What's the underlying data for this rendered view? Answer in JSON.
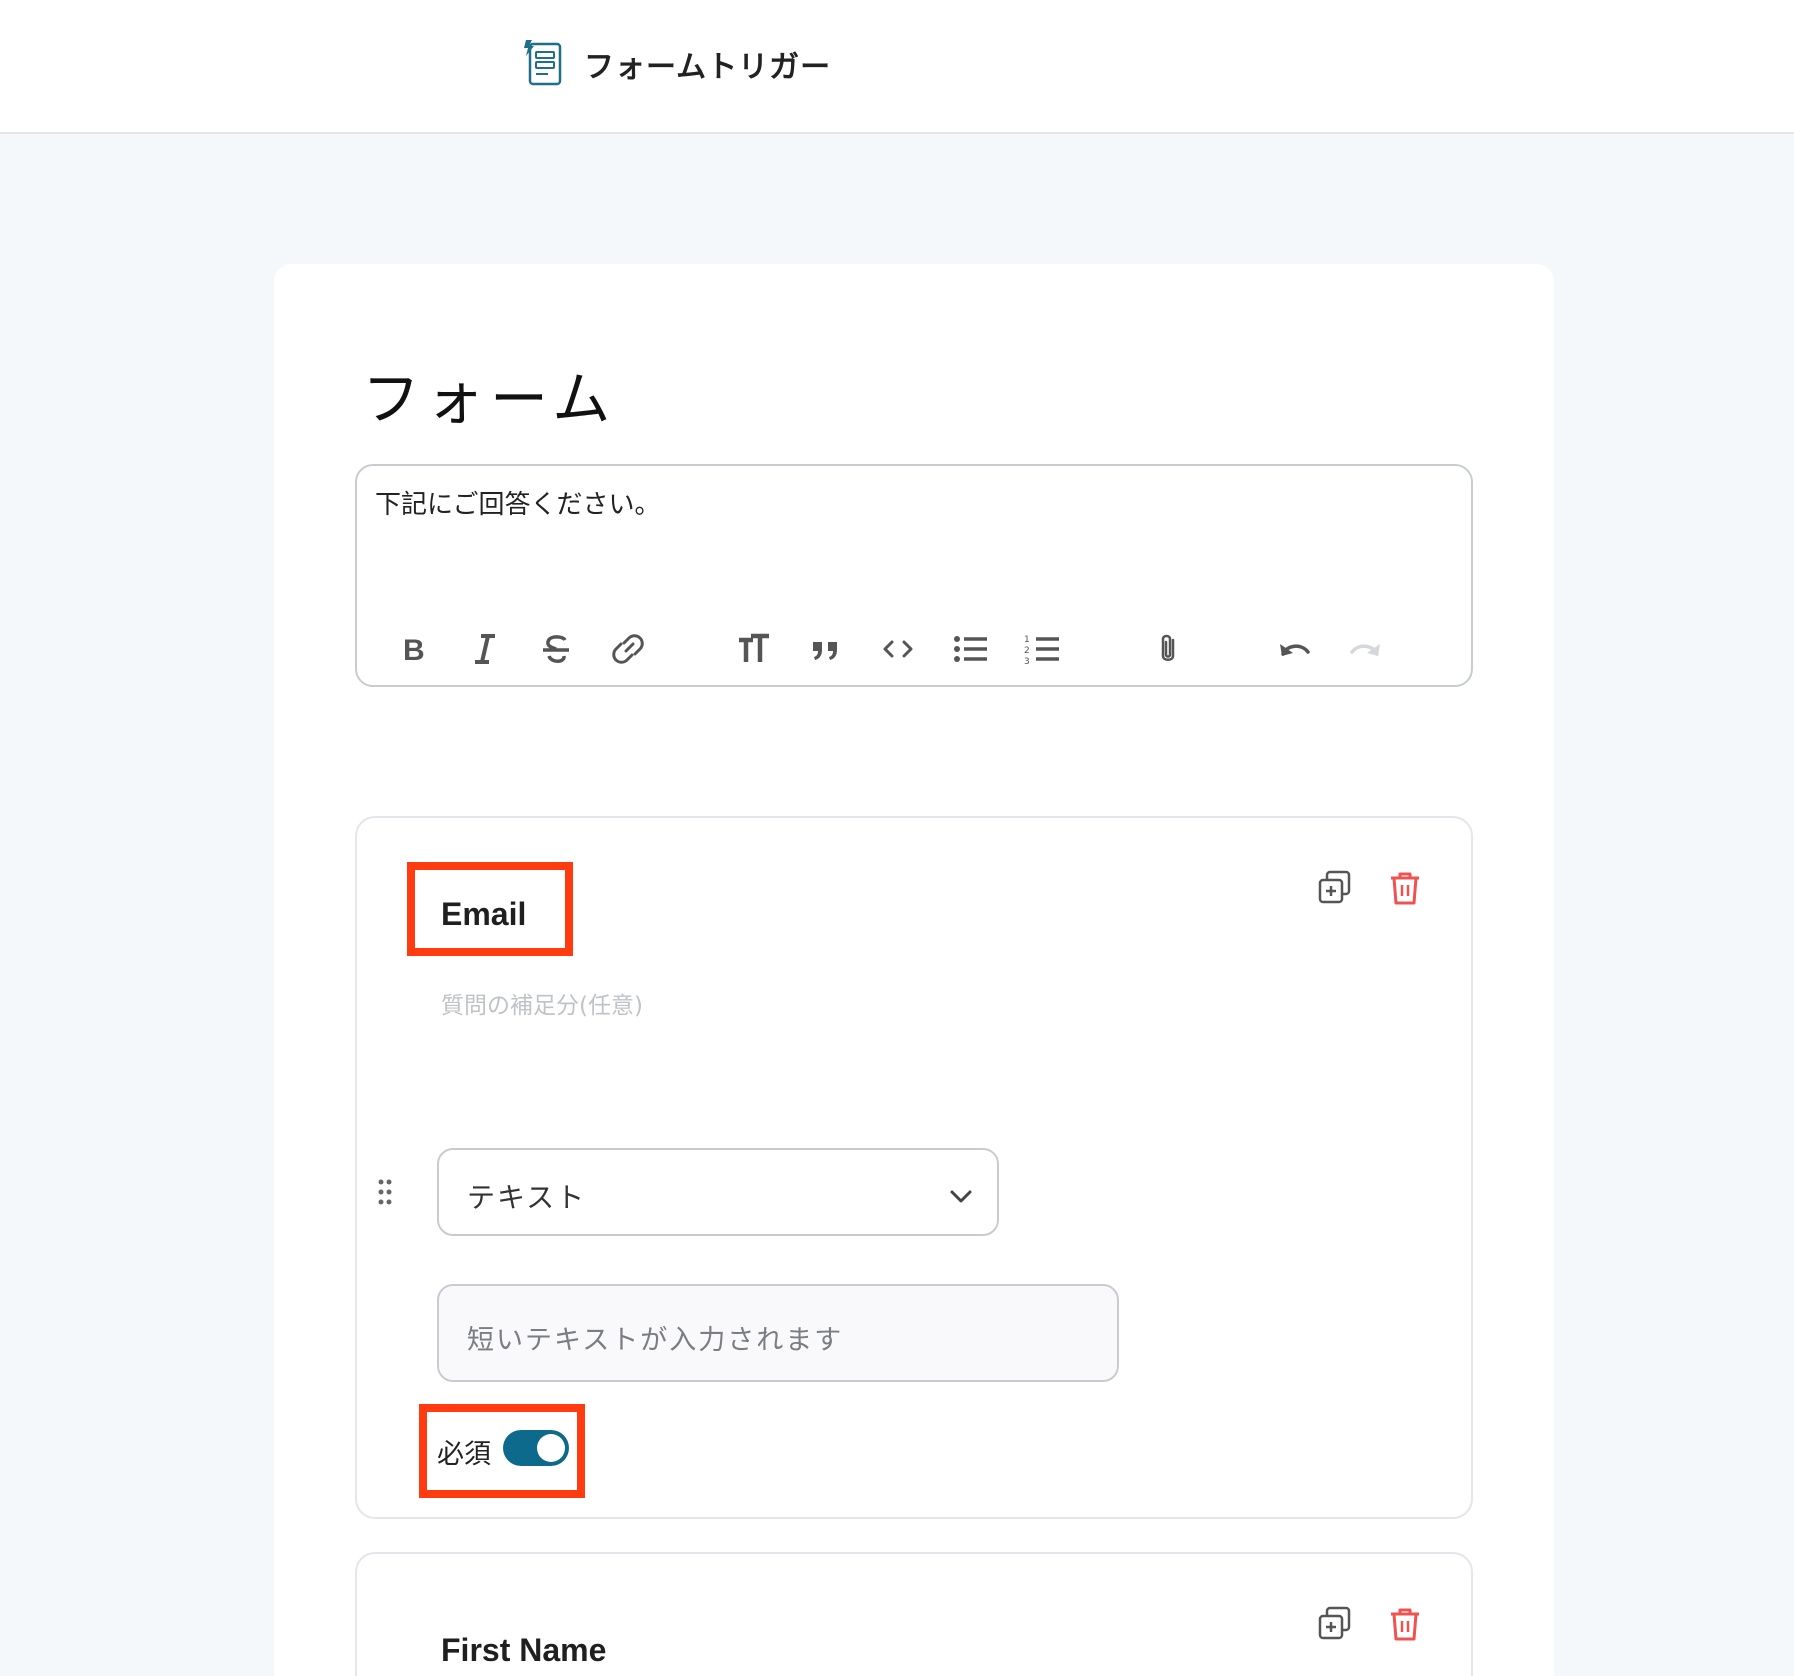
{
  "header": {
    "title": "フォームトリガー",
    "icon": "form-document-icon"
  },
  "form": {
    "title": "フォーム",
    "description": "下記にご回答ください。",
    "toolbar": [
      {
        "name": "bold-icon",
        "enabled": true
      },
      {
        "name": "italic-icon",
        "enabled": true
      },
      {
        "name": "strikethrough-icon",
        "enabled": true
      },
      {
        "name": "link-icon",
        "enabled": true
      },
      {
        "name": "heading-icon",
        "enabled": true
      },
      {
        "name": "quote-icon",
        "enabled": true
      },
      {
        "name": "code-icon",
        "enabled": true
      },
      {
        "name": "bullet-list-icon",
        "enabled": true
      },
      {
        "name": "numbered-list-icon",
        "enabled": true
      },
      {
        "name": "attachment-icon",
        "enabled": true
      },
      {
        "name": "undo-icon",
        "enabled": true
      },
      {
        "name": "redo-icon",
        "enabled": false
      }
    ]
  },
  "questions": [
    {
      "title": "Email",
      "subtitle_placeholder": "質問の補足分(任意)",
      "type": "テキスト",
      "answer_placeholder": "短いテキストが入力されます",
      "required_label": "必須",
      "required": true
    },
    {
      "title": "First Name"
    }
  ],
  "colors": {
    "accent": "#0e6a8c",
    "highlight": "#ff3b0f",
    "delete": "#f0524f",
    "background": "#f5f8fa"
  }
}
